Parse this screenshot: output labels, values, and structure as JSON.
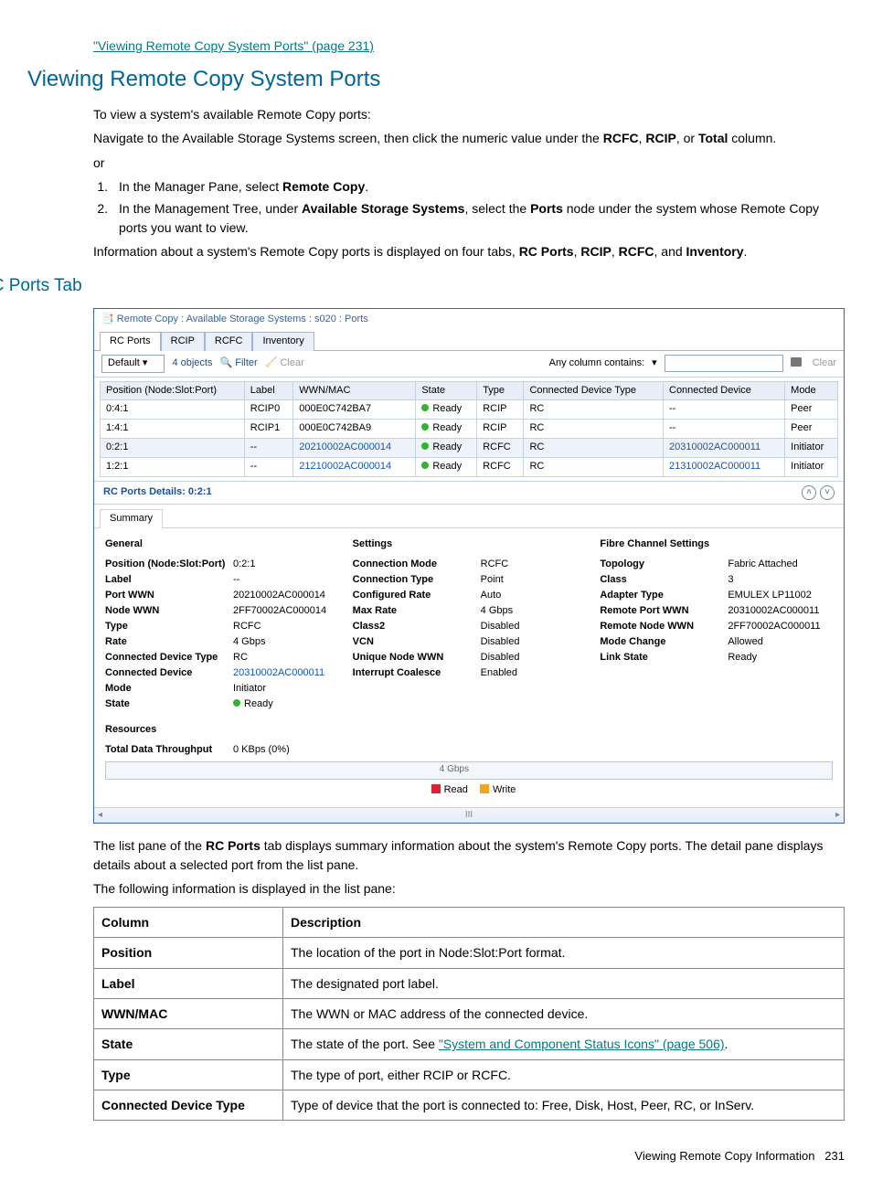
{
  "toplink": "\"Viewing Remote Copy System Ports\" (page 231)",
  "h1": "Viewing Remote Copy System Ports",
  "intro": {
    "p1": "To view a system's available Remote Copy ports:",
    "p2_a": "Navigate to the Available Storage Systems screen, then click the numeric value under the ",
    "p2_b": "RCFC",
    "p2_c": ", ",
    "p2_d": "RCIP",
    "p2_e": ", or ",
    "p2_f": "Total",
    "p2_g": " column.",
    "or": "or",
    "li1_a": "In the Manager Pane, select ",
    "li1_b": "Remote Copy",
    "li1_c": ".",
    "li2_a": "In the Management Tree, under ",
    "li2_b": "Available Storage Systems",
    "li2_c": ", select the ",
    "li2_d": "Ports",
    "li2_e": " node under the system whose Remote Copy ports you want to view.",
    "p3_a": "Information about a system's Remote Copy ports is displayed on four tabs, ",
    "p3_b": "RC Ports",
    "p3_c": ", ",
    "p3_d": "RCIP",
    "p3_e": ", ",
    "p3_f": "RCFC",
    "p3_g": ", and ",
    "p3_h": "Inventory",
    "p3_i": "."
  },
  "h2": "RC Ports Tab",
  "shot": {
    "title": "Remote Copy : Available Storage Systems : s020 : Ports",
    "tabs": [
      "RC Ports",
      "RCIP",
      "RCFC",
      "Inventory"
    ],
    "toolbar": {
      "select": "Default",
      "objects": "4 objects",
      "filter": "Filter",
      "clear": "Clear",
      "contains": "Any column contains:",
      "print_clear": "Clear"
    },
    "headers": [
      "Position (Node:Slot:Port)",
      "Label",
      "WWN/MAC",
      "State",
      "Type",
      "Connected Device Type",
      "Connected Device",
      "Mode"
    ],
    "rows": [
      {
        "pos": "0:4:1",
        "label": "RCIP0",
        "wwn": "000E0C742BA7",
        "state": "Ready",
        "type": "RCIP",
        "cdt": "RC",
        "cd": "--",
        "mode": "Peer",
        "alt": false,
        "blue": false
      },
      {
        "pos": "1:4:1",
        "label": "RCIP1",
        "wwn": "000E0C742BA9",
        "state": "Ready",
        "type": "RCIP",
        "cdt": "RC",
        "cd": "--",
        "mode": "Peer",
        "alt": false,
        "blue": false
      },
      {
        "pos": "0:2:1",
        "label": "--",
        "wwn": "20210002AC000014",
        "state": "Ready",
        "type": "RCFC",
        "cdt": "RC",
        "cd": "20310002AC000011",
        "mode": "Initiator",
        "alt": true,
        "blue": true
      },
      {
        "pos": "1:2:1",
        "label": "--",
        "wwn": "21210002AC000014",
        "state": "Ready",
        "type": "RCFC",
        "cdt": "RC",
        "cd": "21310002AC000011",
        "mode": "Initiator",
        "alt": false,
        "blue": true
      }
    ],
    "details_title": "RC Ports Details: 0:2:1",
    "subtab": "Summary",
    "general_h": "General",
    "general": [
      {
        "k": "Position (Node:Slot:Port)",
        "v": "0:2:1"
      },
      {
        "k": "Label",
        "v": "--"
      },
      {
        "k": "Port WWN",
        "v": "20210002AC000014"
      },
      {
        "k": "Node WWN",
        "v": "2FF70002AC000014"
      },
      {
        "k": "Type",
        "v": "RCFC"
      },
      {
        "k": "Rate",
        "v": "4 Gbps"
      },
      {
        "k": "Connected Device Type",
        "v": "RC"
      },
      {
        "k": "Connected Device",
        "v": "20310002AC000011",
        "blue": true
      },
      {
        "k": "Mode",
        "v": "Initiator"
      },
      {
        "k": "State",
        "v": "Ready",
        "green": true
      }
    ],
    "settings_h": "Settings",
    "settings": [
      {
        "k": "Connection Mode",
        "v": "RCFC"
      },
      {
        "k": "Connection Type",
        "v": "Point"
      },
      {
        "k": "Configured Rate",
        "v": "Auto"
      },
      {
        "k": "Max Rate",
        "v": "4 Gbps"
      },
      {
        "k": "Class2",
        "v": "Disabled"
      },
      {
        "k": "VCN",
        "v": "Disabled"
      },
      {
        "k": "Unique Node WWN",
        "v": "Disabled"
      },
      {
        "k": "Interrupt Coalesce",
        "v": "Enabled"
      }
    ],
    "fc_h": "Fibre Channel Settings",
    "fc": [
      {
        "k": "Topology",
        "v": "Fabric Attached"
      },
      {
        "k": "Class",
        "v": "3"
      },
      {
        "k": "Adapter Type",
        "v": "EMULEX LP11002"
      },
      {
        "k": "Remote Port WWN",
        "v": "20310002AC000011"
      },
      {
        "k": "Remote Node WWN",
        "v": "2FF70002AC000011"
      },
      {
        "k": "Mode Change",
        "v": "Allowed"
      },
      {
        "k": "Link State",
        "v": "Ready"
      }
    ],
    "resources_h": "Resources",
    "throughput_k": "Total Data Throughput",
    "throughput_v": "0 KBps (0%)",
    "bar_mid": "4 Gbps",
    "legend_read": "Read",
    "legend_write": "Write"
  },
  "after": {
    "p1_a": "The list pane of the ",
    "p1_b": "RC Ports",
    "p1_c": " tab displays summary information about the system's Remote Copy ports. The detail pane displays details about a selected port from the list pane.",
    "p2": "The following information is displayed in the list pane:"
  },
  "doc_headers": [
    "Column",
    "Description"
  ],
  "doc_rows": [
    {
      "c": "Position",
      "d": "The location of the port in Node:Slot:Port format."
    },
    {
      "c": "Label",
      "d": "The designated port label."
    },
    {
      "c": "WWN/MAC",
      "d": "The WWN or MAC address of the connected device."
    },
    {
      "c": "State",
      "d_a": "The state of the port. See ",
      "d_link": "\"System and Component Status Icons\" (page 506)",
      "d_b": "."
    },
    {
      "c": "Type",
      "d": "The type of port, either RCIP or RCFC."
    },
    {
      "c": "Connected Device Type",
      "d": "Type of device that the port is connected to: Free, Disk, Host, Peer, RC, or InServ."
    }
  ],
  "footer_a": "Viewing Remote Copy Information",
  "footer_b": "231"
}
